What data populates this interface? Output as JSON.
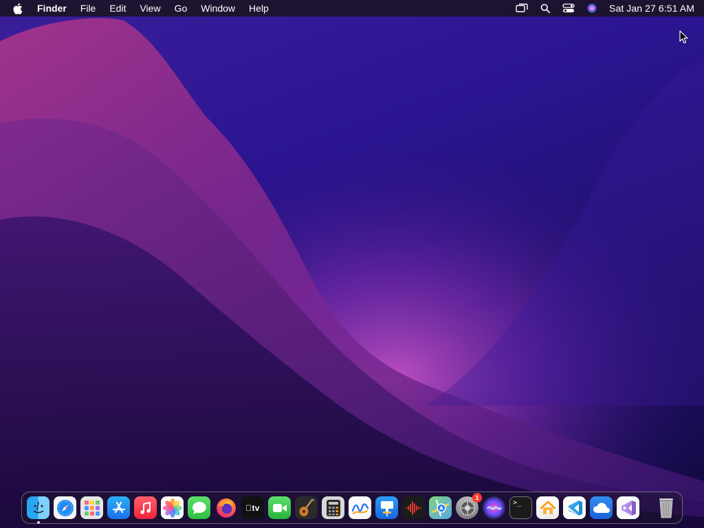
{
  "menubar": {
    "app_name": "Finder",
    "menus": [
      "File",
      "Edit",
      "View",
      "Go",
      "Window",
      "Help"
    ],
    "status_icons": [
      "screen-mirroring-icon",
      "spotlight-search-icon",
      "control-center-icon",
      "siri-icon"
    ],
    "clock": "Sat Jan 27  6:51 AM"
  },
  "dock": {
    "items": [
      {
        "name": "Finder",
        "icon": "finder-icon",
        "running": true
      },
      {
        "name": "Safari",
        "icon": "safari-icon"
      },
      {
        "name": "Launchpad",
        "icon": "launchpad-icon"
      },
      {
        "name": "App Store",
        "icon": "app-store-icon"
      },
      {
        "name": "Music",
        "icon": "music-icon"
      },
      {
        "name": "Photos",
        "icon": "photos-icon"
      },
      {
        "name": "Messages",
        "icon": "messages-icon"
      },
      {
        "name": "Firefox",
        "icon": "firefox-icon"
      },
      {
        "name": "TV",
        "icon": "apple-tv-icon",
        "label": "tv"
      },
      {
        "name": "FaceTime",
        "icon": "facetime-icon"
      },
      {
        "name": "GarageBand",
        "icon": "garageband-icon"
      },
      {
        "name": "Calculator",
        "icon": "calculator-icon"
      },
      {
        "name": "Freeform",
        "icon": "freeform-icon"
      },
      {
        "name": "Keynote",
        "icon": "keynote-icon"
      },
      {
        "name": "Voice Memos",
        "icon": "voice-memos-icon"
      },
      {
        "name": "Maps",
        "icon": "maps-icon"
      },
      {
        "name": "System Settings",
        "icon": "system-settings-icon",
        "badge": "1"
      },
      {
        "name": "Siri",
        "icon": "siri-icon"
      },
      {
        "name": "Terminal",
        "icon": "terminal-icon",
        "label": ">_"
      },
      {
        "name": "Home",
        "icon": "home-icon"
      },
      {
        "name": "Visual Studio Code",
        "icon": "vscode-icon"
      },
      {
        "name": "iCloud",
        "icon": "icloud-icon"
      },
      {
        "name": "Visual Studio",
        "icon": "visual-studio-icon"
      }
    ],
    "trash": {
      "name": "Trash",
      "icon": "trash-icon"
    }
  },
  "colors": {
    "menubar_bg": "#1c1428",
    "wallpaper_top": "#3a1e9a",
    "wallpaper_glow": "#c04ec8",
    "badge": "#ff3b30"
  }
}
